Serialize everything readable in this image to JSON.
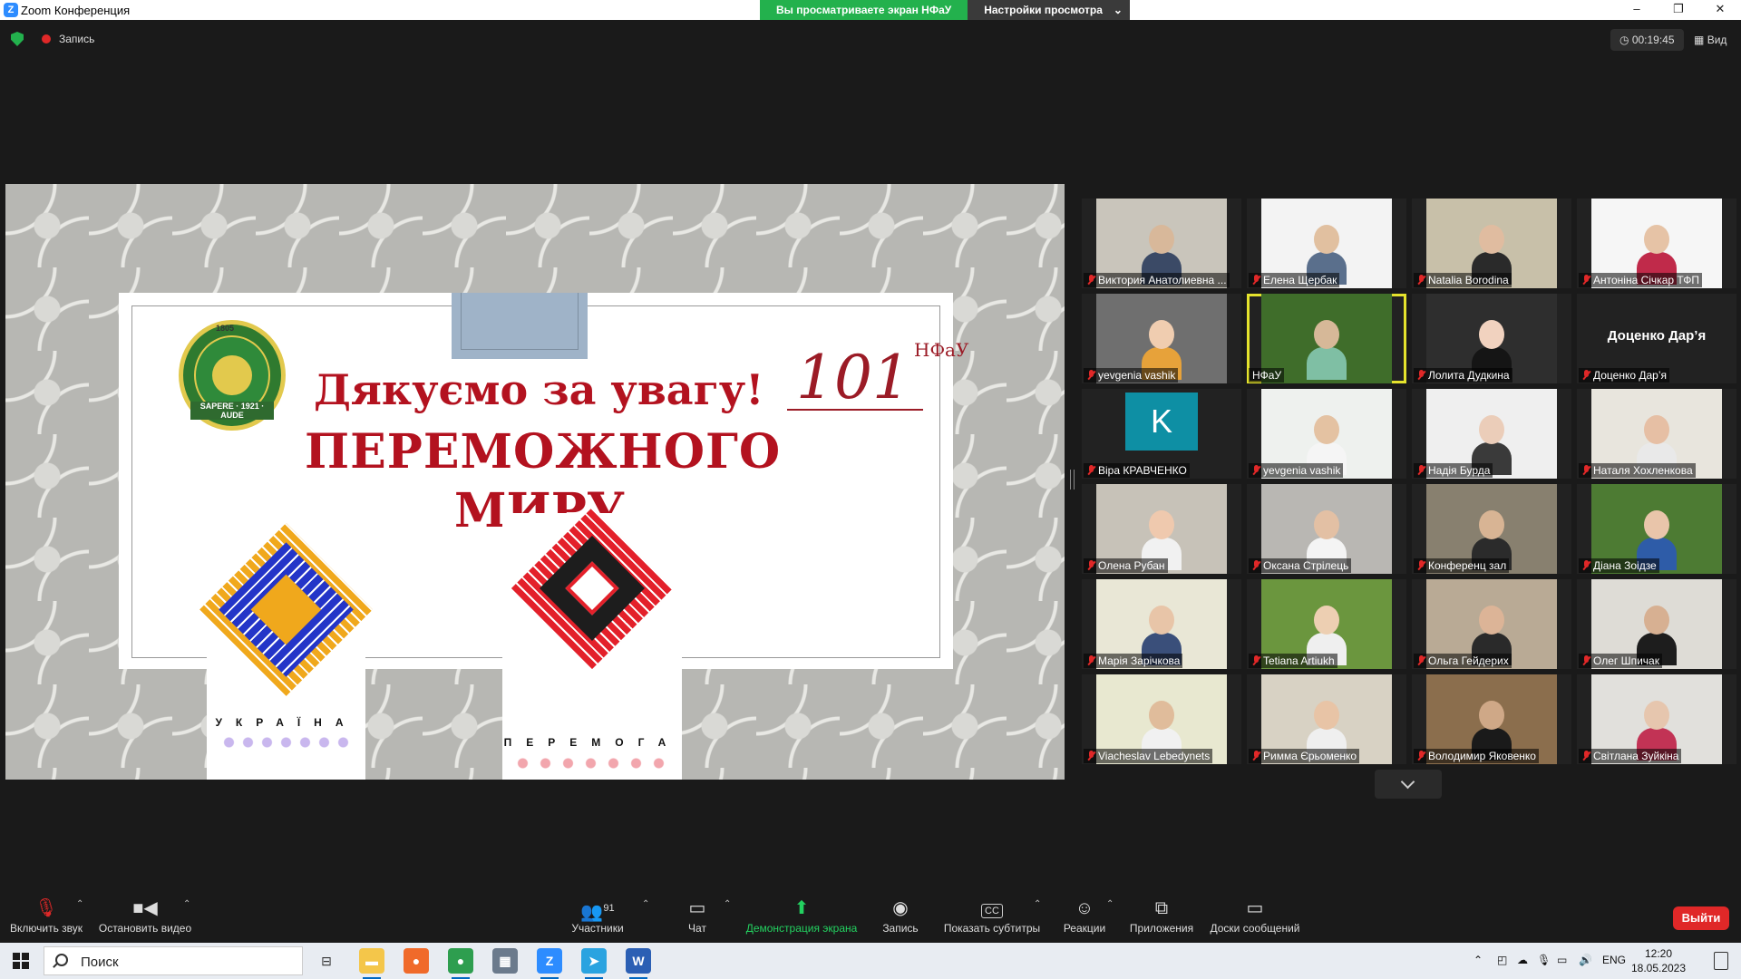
{
  "window": {
    "title": "Zoom Конференция",
    "logo": "Z"
  },
  "share_banner": {
    "viewing": "Вы просматриваете экран НФаУ",
    "settings": "Настройки просмотра"
  },
  "window_controls": {
    "minimize": "–",
    "restore": "❐",
    "close": "✕"
  },
  "meeting": {
    "recording_label": "Запись",
    "timer": "00:19:45",
    "view_label": "Вид",
    "view_icon": "▦"
  },
  "slide": {
    "thanks": "Дякуємо за увагу!",
    "peace_line1": "ПЕРЕМОЖНОГО",
    "peace_line2": "МИРУ",
    "anniversary": "101",
    "university_short": "НФаУ",
    "emblem_year_top": "1805",
    "emblem_motto": "SAPERE · 1921 · AUDE",
    "ornament_left_label": "УКРАЇНА",
    "ornament_right_label": "ПЕРЕМОГА"
  },
  "participants": [
    {
      "name": "Виктория Анатолиевна ...",
      "muted": true,
      "bg": "#c9c5bb",
      "skin": "#d8b89a",
      "cloth": "#3b4a66"
    },
    {
      "name": "Елена Щербак",
      "muted": true,
      "bg": "#f3f3f3",
      "skin": "#e1c0a0",
      "cloth": "#5a6f8c"
    },
    {
      "name": "Natalia Borodina",
      "muted": true,
      "bg": "#c8c0a9",
      "skin": "#e0bca0",
      "cloth": "#2a2a2a"
    },
    {
      "name": "Антоніна Січкар ТФП",
      "muted": true,
      "bg": "#f6f6f6",
      "skin": "#e6c3a6",
      "cloth": "#c02a4a"
    },
    {
      "name": "yevgenia vashik",
      "muted": true,
      "bg": "#6f6f6f",
      "skin": "#f0cdb0",
      "cloth": "#e7a23a"
    },
    {
      "name": "НФаУ",
      "muted": false,
      "bg": "#3f6d2a",
      "skin": "#d6b898",
      "cloth": "#7fbfa4"
    },
    {
      "name": "Лолита Дудкина",
      "muted": true,
      "bg": "#2e2e2e",
      "skin": "#f1d2bf",
      "cloth": "#151515"
    },
    {
      "name": "Доценко Дар’я",
      "muted": true,
      "bg": "#222222",
      "name_only": true
    },
    {
      "name": "Віра КРАВЧЕНКО",
      "muted": true,
      "bg": "#222222",
      "avatar_letter": "K"
    },
    {
      "name": "yevgenia vashik",
      "muted": true,
      "bg": "#eef1ee",
      "skin": "#e4c2a2",
      "cloth": "#f5f5f5"
    },
    {
      "name": "Надія Бурда",
      "muted": true,
      "bg": "#efefef",
      "skin": "#ebcdb9",
      "cloth": "#3a3a3a"
    },
    {
      "name": "Наталя Хохленкова",
      "muted": true,
      "bg": "#e8e5dd",
      "skin": "#e6bfa4",
      "cloth": "#e9e9e9"
    },
    {
      "name": "Олена Рубан",
      "muted": true,
      "bg": "#c7c2b8",
      "skin": "#efc9ae",
      "cloth": "#f1f1f1"
    },
    {
      "name": "Оксана Стрілець",
      "muted": true,
      "bg": "#b9b7b3",
      "skin": "#e3c0a4",
      "cloth": "#f4f4f4"
    },
    {
      "name": "Конференц зал",
      "muted": true,
      "bg": "#88806f",
      "skin": "#d8b494",
      "cloth": "#2b2b2b"
    },
    {
      "name": "Діана Зоідзе",
      "muted": true,
      "bg": "#4d7b33",
      "skin": "#e9c5aa",
      "cloth": "#2e5ca8"
    },
    {
      "name": "Марія Зарічкова",
      "muted": true,
      "bg": "#e9e7d6",
      "skin": "#e8c5a8",
      "cloth": "#3a4f7a"
    },
    {
      "name": "Tetiana Artiukh",
      "muted": true,
      "bg": "#6b963e",
      "skin": "#edcfb2",
      "cloth": "#efefef"
    },
    {
      "name": "Ольга Гейдерих",
      "muted": true,
      "bg": "#b9aa95",
      "skin": "#dcb497",
      "cloth": "#2a2a2a"
    },
    {
      "name": "Олег Шпичак",
      "muted": true,
      "bg": "#dedcd6",
      "skin": "#d7b092",
      "cloth": "#1d1d1d"
    },
    {
      "name": "Viacheslav Lebedynets",
      "muted": true,
      "bg": "#e8e8d0",
      "skin": "#e0bc9b",
      "cloth": "#f1f1f1"
    },
    {
      "name": "Римма Єрьоменко",
      "muted": true,
      "bg": "#d8d2c4",
      "skin": "#e8c4a6",
      "cloth": "#efefef"
    },
    {
      "name": "Володимир Яковенко",
      "muted": true,
      "bg": "#8b6e4d",
      "skin": "#cfa887",
      "cloth": "#1a1a1a"
    },
    {
      "name": "Світлана Зуйкіна",
      "muted": true,
      "bg": "#e1e0dc",
      "skin": "#e6c6ae",
      "cloth": "#c23355"
    }
  ],
  "toolbar": {
    "unmute": "Включить звук",
    "stop_video": "Остановить видео",
    "participants": "Участники",
    "participants_count": "91",
    "chat": "Чат",
    "share_screen": "Демонстрация экрана",
    "record": "Запись",
    "captions": "Показать субтитры",
    "captions_icon_text": "CC",
    "reactions": "Реакции",
    "apps": "Приложения",
    "whiteboards": "Доски сообщений",
    "leave": "Выйти"
  },
  "taskbar": {
    "search_placeholder": "Поиск",
    "lang": "ENG",
    "time": "12:20",
    "date": "18.05.2023",
    "apps": [
      {
        "name": "file-explorer-icon",
        "glyph": "▬",
        "color": "#f4c64a",
        "running": true
      },
      {
        "name": "firefox-icon",
        "glyph": "●",
        "color": "#f06a2a",
        "running": false
      },
      {
        "name": "chrome-icon",
        "glyph": "●",
        "color": "#2e9e4f",
        "running": true
      },
      {
        "name": "calculator-icon",
        "glyph": "▦",
        "color": "#6b7a8c",
        "running": false
      },
      {
        "name": "zoom-icon",
        "glyph": "Z",
        "color": "#2d8cff",
        "running": true
      },
      {
        "name": "telegram-icon",
        "glyph": "➤",
        "color": "#2aa3e0",
        "running": true
      },
      {
        "name": "word-icon",
        "glyph": "W",
        "color": "#2b5fb4",
        "running": true
      }
    ]
  }
}
